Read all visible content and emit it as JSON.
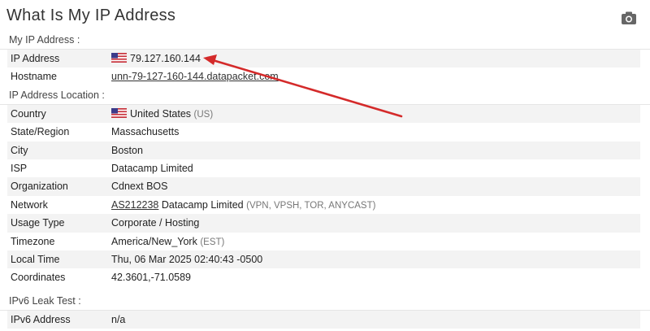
{
  "page": {
    "title": "What Is My IP Address",
    "screenshot_icon": "camera-icon"
  },
  "my_ip": {
    "section_title": "My IP Address :",
    "rows": [
      {
        "label": "IP Address",
        "value": "79.127.160.144",
        "flag": "us-flag-icon"
      },
      {
        "label": "Hostname",
        "value": "unn-79-127-160-144.datapacket.com"
      }
    ]
  },
  "location": {
    "section_title": "IP Address Location :",
    "country": {
      "label": "Country",
      "value": "United States",
      "note": "(US)",
      "flag": "us-flag-icon"
    },
    "state": {
      "label": "State/Region",
      "value": "Massachusetts"
    },
    "city": {
      "label": "City",
      "value": "Boston"
    },
    "isp": {
      "label": "ISP",
      "value": "Datacamp Limited"
    },
    "organization": {
      "label": "Organization",
      "value": "Cdnext BOS"
    },
    "network": {
      "label": "Network",
      "asn": "AS212238",
      "value": "Datacamp Limited",
      "note": "(VPN, VPSH, TOR, ANYCAST)"
    },
    "usage_type": {
      "label": "Usage Type",
      "value": "Corporate / Hosting"
    },
    "timezone": {
      "label": "Timezone",
      "value": "America/New_York",
      "note": "(EST)"
    },
    "local_time": {
      "label": "Local Time",
      "value": "Thu, 06 Mar 2025 02:40:43 -0500"
    },
    "coordinates": {
      "label": "Coordinates",
      "value": "42.3601,-71.0589"
    }
  },
  "ipv6": {
    "section_title": "IPv6 Leak Test :",
    "rows": [
      {
        "label": "IPv6 Address",
        "value": "n/a"
      }
    ]
  },
  "annotation": {
    "arrow_color": "#d42a2a"
  }
}
